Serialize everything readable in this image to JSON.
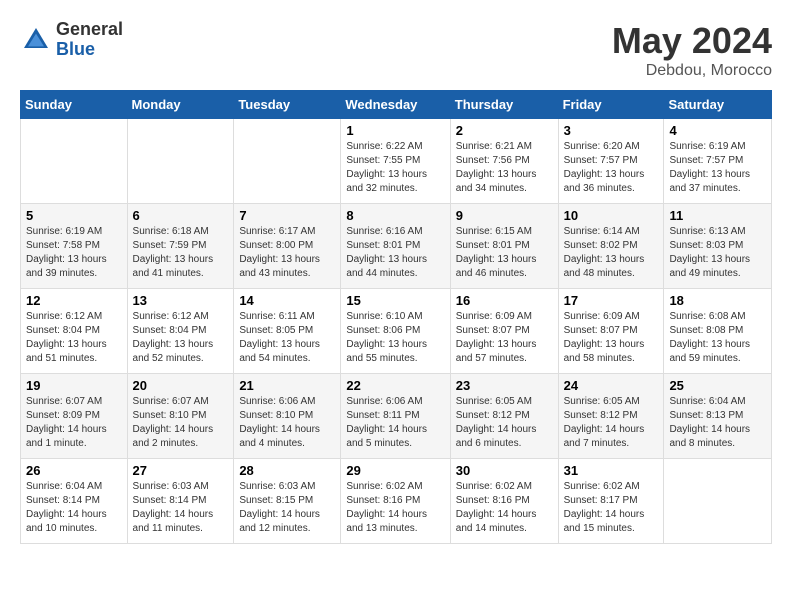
{
  "header": {
    "logo_general": "General",
    "logo_blue": "Blue",
    "month_title": "May 2024",
    "location": "Debdou, Morocco"
  },
  "weekdays": [
    "Sunday",
    "Monday",
    "Tuesday",
    "Wednesday",
    "Thursday",
    "Friday",
    "Saturday"
  ],
  "weeks": [
    {
      "days": [
        {
          "num": "",
          "empty": true
        },
        {
          "num": "",
          "empty": true
        },
        {
          "num": "",
          "empty": true
        },
        {
          "num": "1",
          "sunrise": "6:22 AM",
          "sunset": "7:55 PM",
          "daylight": "13 hours and 32 minutes."
        },
        {
          "num": "2",
          "sunrise": "6:21 AM",
          "sunset": "7:56 PM",
          "daylight": "13 hours and 34 minutes."
        },
        {
          "num": "3",
          "sunrise": "6:20 AM",
          "sunset": "7:57 PM",
          "daylight": "13 hours and 36 minutes."
        },
        {
          "num": "4",
          "sunrise": "6:19 AM",
          "sunset": "7:57 PM",
          "daylight": "13 hours and 37 minutes."
        }
      ]
    },
    {
      "days": [
        {
          "num": "5",
          "sunrise": "6:19 AM",
          "sunset": "7:58 PM",
          "daylight": "13 hours and 39 minutes."
        },
        {
          "num": "6",
          "sunrise": "6:18 AM",
          "sunset": "7:59 PM",
          "daylight": "13 hours and 41 minutes."
        },
        {
          "num": "7",
          "sunrise": "6:17 AM",
          "sunset": "8:00 PM",
          "daylight": "13 hours and 43 minutes."
        },
        {
          "num": "8",
          "sunrise": "6:16 AM",
          "sunset": "8:01 PM",
          "daylight": "13 hours and 44 minutes."
        },
        {
          "num": "9",
          "sunrise": "6:15 AM",
          "sunset": "8:01 PM",
          "daylight": "13 hours and 46 minutes."
        },
        {
          "num": "10",
          "sunrise": "6:14 AM",
          "sunset": "8:02 PM",
          "daylight": "13 hours and 48 minutes."
        },
        {
          "num": "11",
          "sunrise": "6:13 AM",
          "sunset": "8:03 PM",
          "daylight": "13 hours and 49 minutes."
        }
      ]
    },
    {
      "days": [
        {
          "num": "12",
          "sunrise": "6:12 AM",
          "sunset": "8:04 PM",
          "daylight": "13 hours and 51 minutes."
        },
        {
          "num": "13",
          "sunrise": "6:12 AM",
          "sunset": "8:04 PM",
          "daylight": "13 hours and 52 minutes."
        },
        {
          "num": "14",
          "sunrise": "6:11 AM",
          "sunset": "8:05 PM",
          "daylight": "13 hours and 54 minutes."
        },
        {
          "num": "15",
          "sunrise": "6:10 AM",
          "sunset": "8:06 PM",
          "daylight": "13 hours and 55 minutes."
        },
        {
          "num": "16",
          "sunrise": "6:09 AM",
          "sunset": "8:07 PM",
          "daylight": "13 hours and 57 minutes."
        },
        {
          "num": "17",
          "sunrise": "6:09 AM",
          "sunset": "8:07 PM",
          "daylight": "13 hours and 58 minutes."
        },
        {
          "num": "18",
          "sunrise": "6:08 AM",
          "sunset": "8:08 PM",
          "daylight": "13 hours and 59 minutes."
        }
      ]
    },
    {
      "days": [
        {
          "num": "19",
          "sunrise": "6:07 AM",
          "sunset": "8:09 PM",
          "daylight": "14 hours and 1 minute."
        },
        {
          "num": "20",
          "sunrise": "6:07 AM",
          "sunset": "8:10 PM",
          "daylight": "14 hours and 2 minutes."
        },
        {
          "num": "21",
          "sunrise": "6:06 AM",
          "sunset": "8:10 PM",
          "daylight": "14 hours and 4 minutes."
        },
        {
          "num": "22",
          "sunrise": "6:06 AM",
          "sunset": "8:11 PM",
          "daylight": "14 hours and 5 minutes."
        },
        {
          "num": "23",
          "sunrise": "6:05 AM",
          "sunset": "8:12 PM",
          "daylight": "14 hours and 6 minutes."
        },
        {
          "num": "24",
          "sunrise": "6:05 AM",
          "sunset": "8:12 PM",
          "daylight": "14 hours and 7 minutes."
        },
        {
          "num": "25",
          "sunrise": "6:04 AM",
          "sunset": "8:13 PM",
          "daylight": "14 hours and 8 minutes."
        }
      ]
    },
    {
      "days": [
        {
          "num": "26",
          "sunrise": "6:04 AM",
          "sunset": "8:14 PM",
          "daylight": "14 hours and 10 minutes."
        },
        {
          "num": "27",
          "sunrise": "6:03 AM",
          "sunset": "8:14 PM",
          "daylight": "14 hours and 11 minutes."
        },
        {
          "num": "28",
          "sunrise": "6:03 AM",
          "sunset": "8:15 PM",
          "daylight": "14 hours and 12 minutes."
        },
        {
          "num": "29",
          "sunrise": "6:02 AM",
          "sunset": "8:16 PM",
          "daylight": "14 hours and 13 minutes."
        },
        {
          "num": "30",
          "sunrise": "6:02 AM",
          "sunset": "8:16 PM",
          "daylight": "14 hours and 14 minutes."
        },
        {
          "num": "31",
          "sunrise": "6:02 AM",
          "sunset": "8:17 PM",
          "daylight": "14 hours and 15 minutes."
        },
        {
          "num": "",
          "empty": true
        }
      ]
    }
  ]
}
